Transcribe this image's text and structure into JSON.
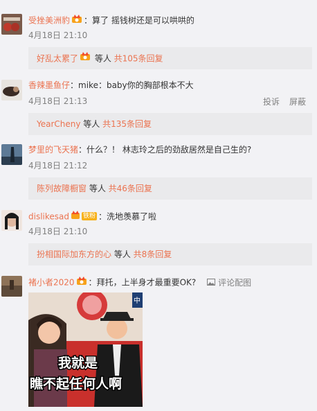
{
  "comments": [
    {
      "user": "受挫美洲豹",
      "sep": "：",
      "text": "算了 摇钱树还是可以哄哄的",
      "time": "4月18日 21:10",
      "replies": {
        "user": "好乱太累了",
        "mid": " 等人 ",
        "count": "共105条回复"
      }
    },
    {
      "user": "香辣墨鱼仔",
      "sep": "：",
      "text": "mike：baby你的胸部根本不大",
      "time": "4月18日 21:13",
      "actions": {
        "report": "投诉",
        "block": "屏蔽"
      },
      "replies": {
        "user": "YearCheny",
        "mid": " 等人 ",
        "count": "共135条回复"
      }
    },
    {
      "user": "梦里的飞天猪",
      "sep": "：",
      "text": "什么？！ 林志玲之后的劲敌居然是自己生的?",
      "time": "4月18日 21:12",
      "replies": {
        "user": "陈列故障橱窗",
        "mid": " 等人 ",
        "count": "共46条回复"
      }
    },
    {
      "user": "dislikesad",
      "badge_text": "铁粉",
      "sep": "：",
      "text": "洗地羡慕了啦",
      "time": "4月18日 21:10",
      "replies": {
        "user": "扮相国际加东方的心",
        "mid": " 等人 ",
        "count": "共8条回复"
      }
    },
    {
      "user": "褚小者2020",
      "sep": "：",
      "text": "拜托，上半身才最重要OK?",
      "pic_link": "评论配图",
      "image": {
        "caption_top": "我就是",
        "caption_bottom": "瞧不起任何人啊",
        "logo": "中"
      }
    }
  ],
  "colors": {
    "username": "#eb7350",
    "text": "#333333",
    "meta": "#808080",
    "reply_bg": "#eaeaec",
    "page_bg": "#f2f2f5"
  },
  "icons": {
    "vip_badge": "crown-badge-icon",
    "picture": "picture-icon"
  }
}
